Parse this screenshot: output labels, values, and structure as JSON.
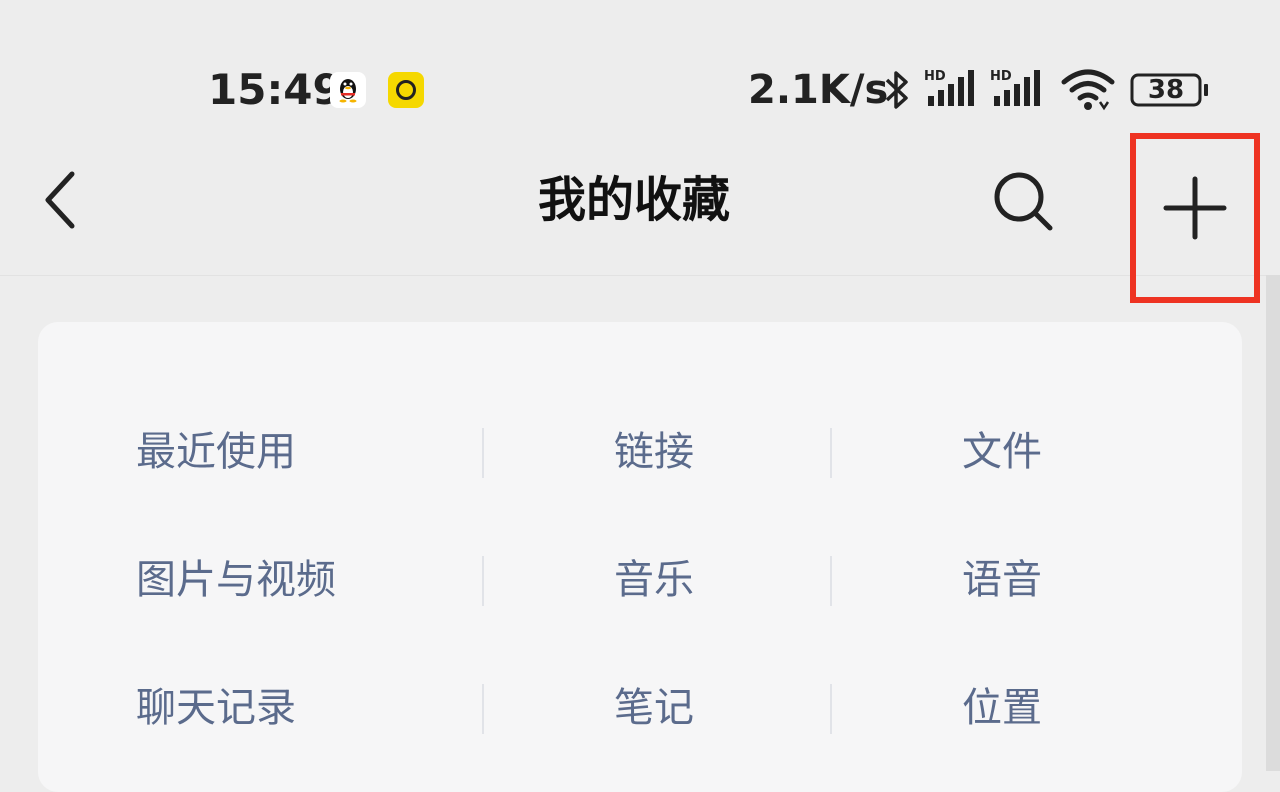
{
  "status_bar": {
    "time": "15:49",
    "net_speed": "2.1K/s",
    "battery": "38",
    "signal_label": "HD",
    "icons": [
      "qq-icon",
      "app-circle-icon",
      "bluetooth-icon",
      "signal-icon",
      "signal-icon",
      "wifi-icon",
      "battery-icon"
    ]
  },
  "nav": {
    "title": "我的收藏",
    "back_icon": "chevron-left-icon",
    "search_icon": "search-icon",
    "add_icon": "plus-icon",
    "highlight_color": "#ee3322"
  },
  "categories": [
    [
      "最近使用",
      "链接",
      "文件"
    ],
    [
      "图片与视频",
      "音乐",
      "语音"
    ],
    [
      "聊天记录",
      "笔记",
      "位置"
    ]
  ],
  "colors": {
    "category_text": "#5b6b8c",
    "background": "#ededed",
    "card": "#f6f6f7"
  }
}
